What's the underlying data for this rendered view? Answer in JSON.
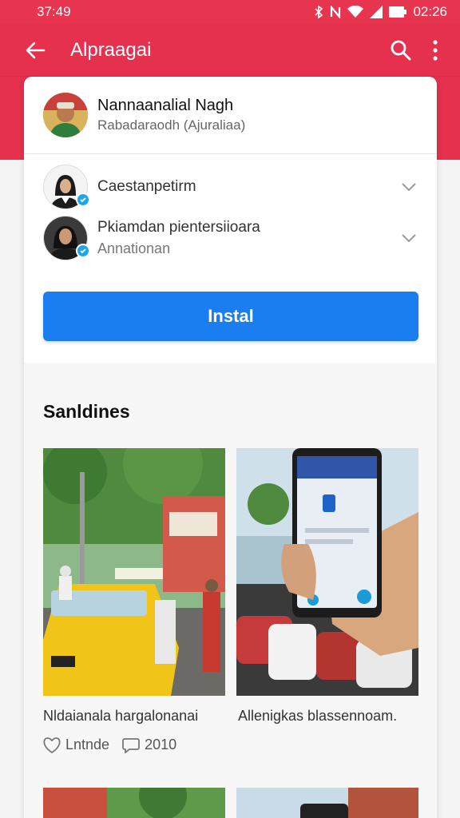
{
  "status_bar": {
    "time": "37:49",
    "clock": "02:26"
  },
  "app_bar": {
    "title": "Alpraagai"
  },
  "profile": {
    "name": "Nannaanalial Nagh",
    "subtitle": "Rabadaraodh (Ajuraliaa)"
  },
  "options": [
    {
      "label": "Caestanpetirm",
      "sub": ""
    },
    {
      "label": "Pkiamdan pientersiioara",
      "sub": "Annationan"
    }
  ],
  "install_label": "Instal",
  "section_title": "Sanldines",
  "items": [
    {
      "caption": "Nldaianala hargalonanai"
    },
    {
      "caption": "Allenigkas blassennoam."
    }
  ],
  "meta": {
    "likes": "Lntnde",
    "comments": "2010"
  },
  "colors": {
    "header": "#e5304e",
    "accent": "#1a7df0",
    "verified": "#1ea7e8"
  },
  "icons": [
    "arrow-back-icon",
    "search-icon",
    "more-vert-icon",
    "chevron-down-icon",
    "heart-icon",
    "comment-icon",
    "verified-icon"
  ]
}
